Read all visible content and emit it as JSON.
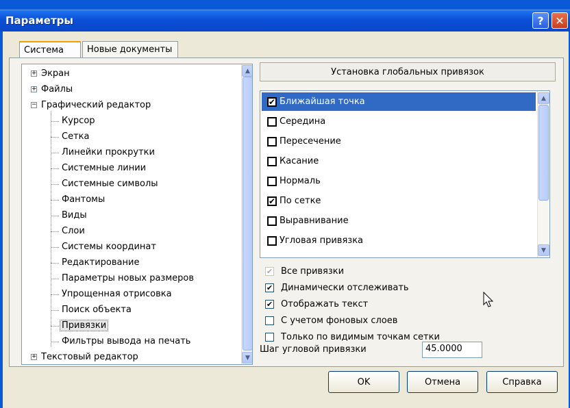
{
  "window": {
    "title": "Параметры",
    "help_glyph": "?",
    "close_glyph": "✕"
  },
  "tabs": [
    {
      "label": "Система",
      "active": true
    },
    {
      "label": "Новые документы",
      "active": false
    }
  ],
  "tree": {
    "items": [
      {
        "label": "Экран",
        "level": 0,
        "expander": "+"
      },
      {
        "label": "Файлы",
        "level": 0,
        "expander": "+"
      },
      {
        "label": "Графический редактор",
        "level": 0,
        "expander": "−"
      },
      {
        "label": "Курсор",
        "level": 1
      },
      {
        "label": "Сетка",
        "level": 1
      },
      {
        "label": "Линейки прокрутки",
        "level": 1
      },
      {
        "label": "Системные линии",
        "level": 1
      },
      {
        "label": "Системные символы",
        "level": 1
      },
      {
        "label": "Фантомы",
        "level": 1
      },
      {
        "label": "Виды",
        "level": 1
      },
      {
        "label": "Слои",
        "level": 1
      },
      {
        "label": "Системы координат",
        "level": 1
      },
      {
        "label": "Редактирование",
        "level": 1
      },
      {
        "label": "Параметры новых размеров",
        "level": 1
      },
      {
        "label": "Упрощенная отрисовка",
        "level": 1
      },
      {
        "label": "Поиск объекта",
        "level": 1
      },
      {
        "label": "Привязки",
        "level": 1,
        "selected": true
      },
      {
        "label": "Фильтры вывода на печать",
        "level": 1
      },
      {
        "label": "Текстовый редактор",
        "level": 0,
        "expander": "+"
      }
    ]
  },
  "right_panel": {
    "group_title": "Установка глобальных привязок",
    "snaps": [
      {
        "label": "Ближайшая точка",
        "checked": true,
        "selected": true
      },
      {
        "label": "Середина",
        "checked": false
      },
      {
        "label": "Пересечение",
        "checked": false
      },
      {
        "label": "Касание",
        "checked": false
      },
      {
        "label": "Нормаль",
        "checked": false
      },
      {
        "label": "По сетке",
        "checked": true
      },
      {
        "label": "Выравнивание",
        "checked": false
      },
      {
        "label": "Угловая привязка",
        "checked": false
      }
    ],
    "options": [
      {
        "label": "Все привязки",
        "checked": true,
        "disabled": true
      },
      {
        "label": "Динамически отслеживать",
        "checked": true
      },
      {
        "label": "Отображать текст",
        "checked": true
      },
      {
        "label": "С учетом фоновых слоев",
        "checked": false
      },
      {
        "label": "Только по видимым точкам сетки",
        "checked": false
      }
    ],
    "step_label": "Шаг угловой привязки",
    "step_value": "45.0000"
  },
  "buttons": {
    "ok": "OK",
    "cancel": "Отмена",
    "help": "Справка"
  },
  "colors": {
    "selection": "#316ac5",
    "titlebar": "#0b4fd6",
    "dialog_bg": "#ece9d8"
  }
}
